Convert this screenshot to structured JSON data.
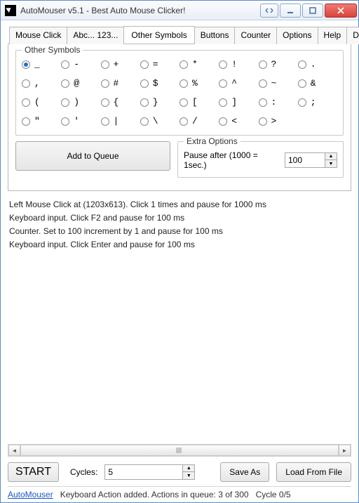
{
  "window": {
    "title": "AutoMouser v5.1 - Best Auto Mouse Clicker!"
  },
  "tabs": [
    "Mouse Click",
    "Abc... 123...",
    "Other Symbols",
    "Buttons",
    "Counter",
    "Options",
    "Help",
    "Donate"
  ],
  "active_tab": 2,
  "symbols_group": {
    "legend": "Other Symbols"
  },
  "symbols": [
    "_",
    "-",
    "+",
    "=",
    "*",
    "!",
    "?",
    ".",
    ",",
    "@",
    "#",
    "$",
    "%",
    "^",
    "~",
    "&",
    "(",
    ")",
    "{",
    "}",
    "[",
    "]",
    ":",
    ";",
    "\"",
    "'",
    "|",
    "\\",
    "/",
    "<",
    ">"
  ],
  "selected_symbol_index": 0,
  "add_to_queue": "Add to Queue",
  "extra_options": {
    "legend": "Extra Options",
    "pause_label": "Pause after (1000 = 1sec.)",
    "pause_value": "100"
  },
  "log": [
    "Left Mouse Click at  (1203x613). Click 1 times and pause for 1000 ms",
    "Keyboard input. Click F2 and pause for 100 ms",
    "Counter. Set to 100 increment by 1 and pause for 100 ms",
    "Keyboard input. Click Enter and pause for 100 ms"
  ],
  "bottom": {
    "start": "START",
    "cycles_label": "Cycles:",
    "cycles_value": "5",
    "save_as": "Save As",
    "load_from_file": "Load From File"
  },
  "status": {
    "link": "AutoMouser",
    "msg": "Keyboard Action added. Actions in queue: 3 of 300",
    "cycle": "Cycle 0/5"
  }
}
